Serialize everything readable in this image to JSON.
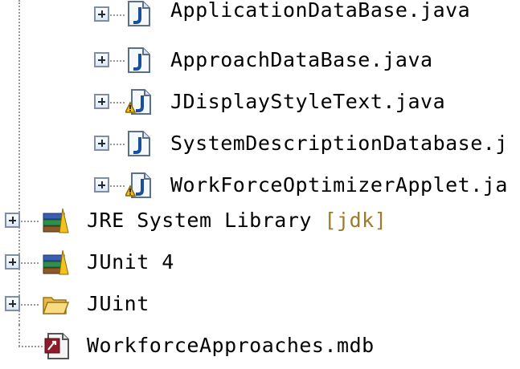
{
  "tree": {
    "java_files": [
      {
        "label": "ApplicationDataBase.java",
        "warning": false
      },
      {
        "label": "ApproachDataBase.java",
        "warning": false
      },
      {
        "label": "JDisplayStyleText.java",
        "warning": true
      },
      {
        "label": "SystemDescriptionDatabase.j",
        "warning": false
      },
      {
        "label": "WorkForceOptimizerApplet.ja",
        "warning": true
      }
    ],
    "libraries": [
      {
        "label": "JRE System Library",
        "decoration": "[jdk]"
      },
      {
        "label": "JUnit 4",
        "decoration": ""
      }
    ],
    "folder": {
      "label": "JUint"
    },
    "file": {
      "label": "WorkforceApproaches.mdb"
    }
  },
  "colors": {
    "java_icon": "#1a4f9c",
    "warning": "#f3c21c",
    "folder": "#f4cf63",
    "decoration": "#9a7a2c",
    "tree_line": "#9a9a9a"
  },
  "icons": {
    "java_file": "java-file-icon",
    "warning": "warning-icon",
    "library": "library-icon",
    "folder": "folder-icon",
    "file": "mdb-file-icon"
  }
}
